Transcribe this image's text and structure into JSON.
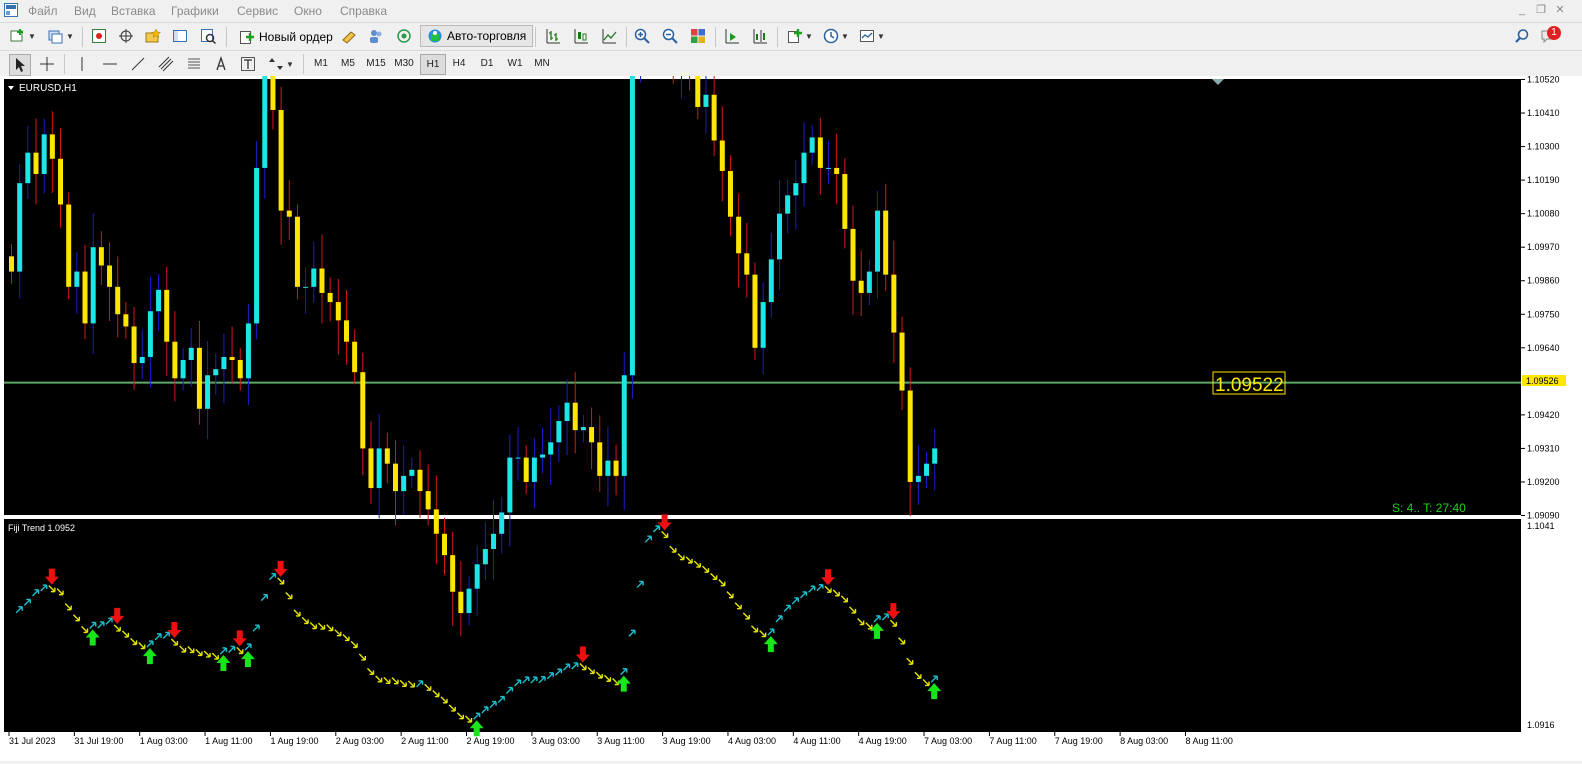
{
  "menu": {
    "items": [
      "Файл",
      "Вид",
      "Вставка",
      "Графики",
      "Сервис",
      "Окно",
      "Справка"
    ]
  },
  "window_controls": [
    "_",
    "❐",
    "✕"
  ],
  "toolbar": {
    "new_order_label": "Новый ордер",
    "auto_trading_label": "Авто-торговля",
    "notification_count": "1"
  },
  "timeframes": [
    "M1",
    "M5",
    "M15",
    "M30",
    "H1",
    "H4",
    "D1",
    "W1",
    "MN"
  ],
  "active_timeframe": "H1",
  "chart": {
    "symbol_label": "EURUSD,H1",
    "price_axis": [
      "1.10520",
      "1.10410",
      "1.10300",
      "1.10190",
      "1.10080",
      "1.09970",
      "1.09860",
      "1.09750",
      "1.09640",
      "1.09526",
      "1.09420",
      "1.09310",
      "1.09200",
      "1.09090"
    ],
    "current_price_tag": "1.09526",
    "price_label_big": "1.09522",
    "status_text": "S: 4.. T: 27:40",
    "colors": {
      "bull": "#1ee6e6",
      "bear": "#ffe600",
      "wick_bull": "#1c1ccf",
      "wick_bear": "#d41818",
      "hline": "#5fa86a",
      "status": "#1bd11b",
      "tag_bg": "#ffe600"
    }
  },
  "indicator": {
    "label": "Fiji Trend 1.0952",
    "axis_top": "1.1041",
    "axis_bottom": "1.0916",
    "colors": {
      "up_arrow": "#1dbfcf",
      "down_arrow": "#e6e600",
      "buy_signal": "#19e619",
      "sell_signal": "#ee1010"
    }
  },
  "time_axis": [
    "31 Jul 2023",
    "31 Jul 19:00",
    "1 Aug 03:00",
    "1 Aug 11:00",
    "1 Aug 19:00",
    "2 Aug 03:00",
    "2 Aug 11:00",
    "2 Aug 19:00",
    "3 Aug 03:00",
    "3 Aug 11:00",
    "3 Aug 19:00",
    "4 Aug 03:00",
    "4 Aug 11:00",
    "4 Aug 19:00",
    "7 Aug 03:00",
    "7 Aug 11:00",
    "7 Aug 19:00",
    "8 Aug 03:00",
    "8 Aug 11:00"
  ],
  "chart_data": {
    "type": "candlestick",
    "series": [
      {
        "name": "EURUSD,H1",
        "close": [
          1.0989,
          1.1018,
          1.1028,
          1.1021,
          1.1034,
          1.1026,
          1.1011,
          1.0984,
          1.0989,
          1.0972,
          1.0997,
          1.0991,
          1.0984,
          1.0975,
          1.0971,
          1.0959,
          1.0961,
          1.0976,
          1.0983,
          1.0966,
          1.0954,
          1.096,
          1.0964,
          1.0944,
          1.0955,
          1.0957,
          1.0961,
          1.096,
          1.0954,
          1.0972,
          1.1023,
          1.1056,
          1.1042,
          1.1009,
          1.1007,
          1.0984,
          1.0984,
          1.099,
          1.0982,
          1.0979,
          1.0973,
          1.0966,
          1.0956,
          1.0931,
          1.0918,
          1.0931,
          1.0926,
          1.0917,
          1.0922,
          1.0924,
          1.0917,
          1.0911,
          1.0903,
          1.0896,
          1.0884,
          1.0877,
          1.0885,
          1.0893,
          1.0898,
          1.0903,
          1.091,
          1.0928,
          1.0928,
          1.092,
          1.0928,
          1.0929,
          1.0933,
          1.094,
          1.0946,
          1.0937,
          1.0938,
          1.0933,
          1.0922,
          1.0927,
          1.0922,
          1.0955,
          1.1055,
          1.1085,
          1.1106,
          1.1089,
          1.1067,
          1.1057,
          1.1064,
          1.1056,
          1.1043,
          1.1047,
          1.1032,
          1.1022,
          1.1007,
          1.0995,
          1.0988,
          1.0964,
          1.0979,
          1.0993,
          1.1008,
          1.1014,
          1.1018,
          1.1028,
          1.1033,
          1.1023,
          1.1023,
          1.1021,
          1.1003,
          1.0986,
          1.0982,
          1.0989,
          1.1009,
          1.0988,
          1.0969,
          1.095,
          1.092,
          1.0922,
          1.0926,
          1.0931
        ]
      }
    ],
    "x": [
      "31 Jul 2023",
      "31 Jul 19:00",
      "1 Aug 03:00",
      "1 Aug 11:00",
      "1 Aug 19:00",
      "2 Aug 03:00",
      "2 Aug 11:00",
      "2 Aug 19:00",
      "3 Aug 03:00",
      "3 Aug 11:00",
      "3 Aug 19:00",
      "4 Aug 03:00",
      "4 Aug 11:00",
      "4 Aug 19:00",
      "7 Aug 03:00",
      "7 Aug 11:00",
      "7 Aug 19:00",
      "8 Aug 03:00",
      "8 Aug 11:00"
    ],
    "ylim": [
      1.0909,
      1.1052
    ],
    "horizontal_line": 1.09526
  }
}
